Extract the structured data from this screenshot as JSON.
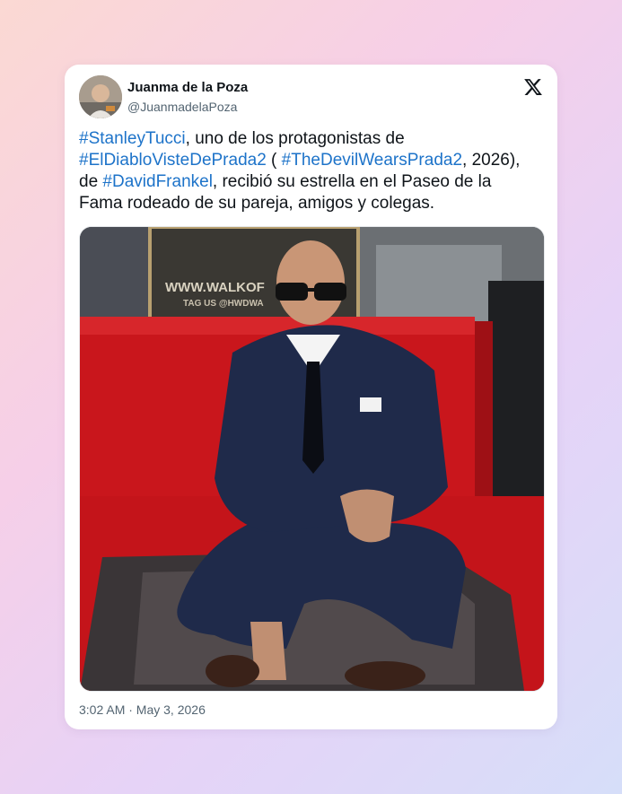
{
  "author": {
    "name": "Juanma de la Poza",
    "handle": "@JuanmadelaPoza"
  },
  "icons": {
    "brand": "x-logo-icon",
    "avatar": "avatar"
  },
  "tweet": {
    "tag1": "#StanleyTucci",
    "text1": ", uno de los protagonistas de",
    "tag2": "#ElDiabloVisteDePrada2",
    "text2": " ( ",
    "tag3": "#TheDevilWearsPrada2",
    "text3": ", 2026),",
    "text4": "de ",
    "tag4": "#DavidFrankel",
    "text5": ", recibió su estrella en el Paseo de la Fama rodeado de su pareja, amigos y colegas."
  },
  "photo": {
    "sign_line1": "WWW.WALKOF",
    "sign_line2": "TAG US @HWDWA"
  },
  "timestamp": "3:02 AM · May 3, 2026",
  "colors": {
    "hashtag": "#1d73c9",
    "carpet": "#c9161c",
    "suit": "#1f2a4a"
  }
}
